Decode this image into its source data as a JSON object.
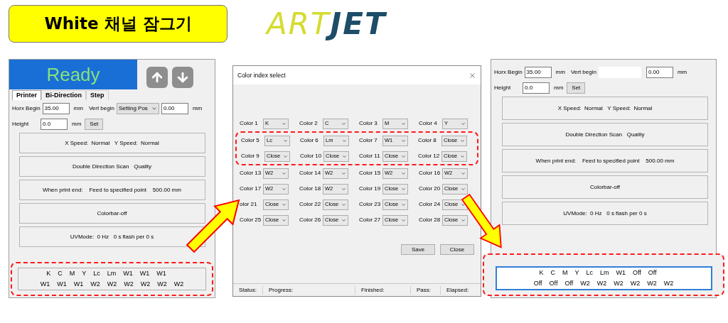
{
  "title": "White 채널 잠그기",
  "logo": [
    "ART",
    "JET"
  ],
  "left_panel": {
    "status": "Ready",
    "tabs": [
      {
        "label": "Printer",
        "selected": true
      },
      {
        "label": "Bi-Direction",
        "selected": false
      },
      {
        "label": "Step",
        "selected": false
      }
    ],
    "horx_label": "Horx Begin",
    "horx_value": "35.00",
    "horx_unit": "mm",
    "vert_label": "Vert begin",
    "vert_mode": "Setting Pos",
    "vert_value": "0.00",
    "vert_unit": "mm",
    "height_label": "Height",
    "height_value": "0.0",
    "height_unit": "mm",
    "set_button": "Set",
    "info_boxes": [
      "X Speed:  Normal   Y Speed:  Normal",
      "Double Direction Scan   Quality",
      "When print end:    Feed to specified point    500.00 mm",
      "Colorbar-off",
      "UVMode:  0 Hz   0 s flash per 0 s"
    ],
    "channel_box": {
      "selected": false,
      "highlighted": true,
      "lines": [
        [
          "K",
          "C",
          "M",
          "Y",
          "Lc",
          "Lm",
          "W1",
          "W1",
          "W1"
        ],
        [
          "W1",
          "W1",
          "W1",
          "W2",
          "W2",
          "W2",
          "W2",
          "W2",
          "W2"
        ]
      ]
    }
  },
  "dialog": {
    "title": "Color index select",
    "rows": [
      {
        "highlighted": false,
        "colors": [
          {
            "label": "Color 1",
            "value": "K"
          },
          {
            "label": "Color 2",
            "value": "C"
          },
          {
            "label": "Color 3",
            "value": "M"
          },
          {
            "label": "Color 4",
            "value": "Y"
          }
        ]
      },
      {
        "highlighted": true,
        "colors": [
          {
            "label": "Color 5",
            "value": "Lc"
          },
          {
            "label": "Color 6",
            "value": "Lm"
          },
          {
            "label": "Color 7",
            "value": "W1"
          },
          {
            "label": "Color 8",
            "value": "Close"
          }
        ]
      },
      {
        "highlighted": true,
        "colors": [
          {
            "label": "Color 9",
            "value": "Close"
          },
          {
            "label": "Color 10",
            "value": "Close"
          },
          {
            "label": "Color 11",
            "value": "Close"
          },
          {
            "label": "Color 12",
            "value": "Close"
          }
        ]
      },
      {
        "highlighted": false,
        "colors": [
          {
            "label": "Color 13",
            "value": "W2"
          },
          {
            "label": "Color 14",
            "value": "W2"
          },
          {
            "label": "Color 15",
            "value": "W2"
          },
          {
            "label": "Color 16",
            "value": "W2"
          }
        ]
      },
      {
        "highlighted": false,
        "colors": [
          {
            "label": "Color 17",
            "value": "W2"
          },
          {
            "label": "Color 18",
            "value": "W2"
          },
          {
            "label": "Color 19",
            "value": "Close"
          },
          {
            "label": "Color 20",
            "value": "Close"
          }
        ]
      },
      {
        "highlighted": false,
        "colors": [
          {
            "label": "olor 21",
            "value": "Close"
          },
          {
            "label": "Color 22",
            "value": "Close"
          },
          {
            "label": "Color 23",
            "value": "Close"
          },
          {
            "label": "Color 24",
            "value": "Close"
          }
        ]
      },
      {
        "highlighted": false,
        "colors": [
          {
            "label": "Color 25",
            "value": "Close"
          },
          {
            "label": "Color 26",
            "value": "Close"
          },
          {
            "label": "Color 27",
            "value": "Close"
          },
          {
            "label": "Color 28",
            "value": "Close"
          }
        ]
      }
    ],
    "buttons": [
      "Save",
      "Close"
    ],
    "status_bar": [
      "Status:",
      "Progress:",
      "Finished:",
      "Pass:",
      "Elapsed:"
    ]
  },
  "right_panel": {
    "horx_label": "Horx Begin",
    "horx_value": "35.00",
    "horx_unit": "mm",
    "vert_label": "Vert begin",
    "vert_value": "0.00",
    "vert_unit": "mm",
    "height_label": "Height",
    "height_value": "0.0",
    "height_unit": "mm",
    "set_button": "Set",
    "info_boxes": [
      "X Speed:  Normal   Y Speed:  Normal",
      "Double Direction Scan   Quality",
      "When print end:    Feed to specified point    500.00 mm",
      "Colorbar-off",
      "UVMode:  0 Hz   0 s flash per 0 s"
    ],
    "channel_box": {
      "selected": true,
      "highlighted": true,
      "lines": [
        [
          "K",
          "C",
          "M",
          "Y",
          "Lc",
          "Lm",
          "W1",
          "Off",
          "Off"
        ],
        [
          "Off",
          "Off",
          "Off",
          "W2",
          "W2",
          "W2",
          "W2",
          "W2",
          "W2"
        ]
      ]
    }
  }
}
